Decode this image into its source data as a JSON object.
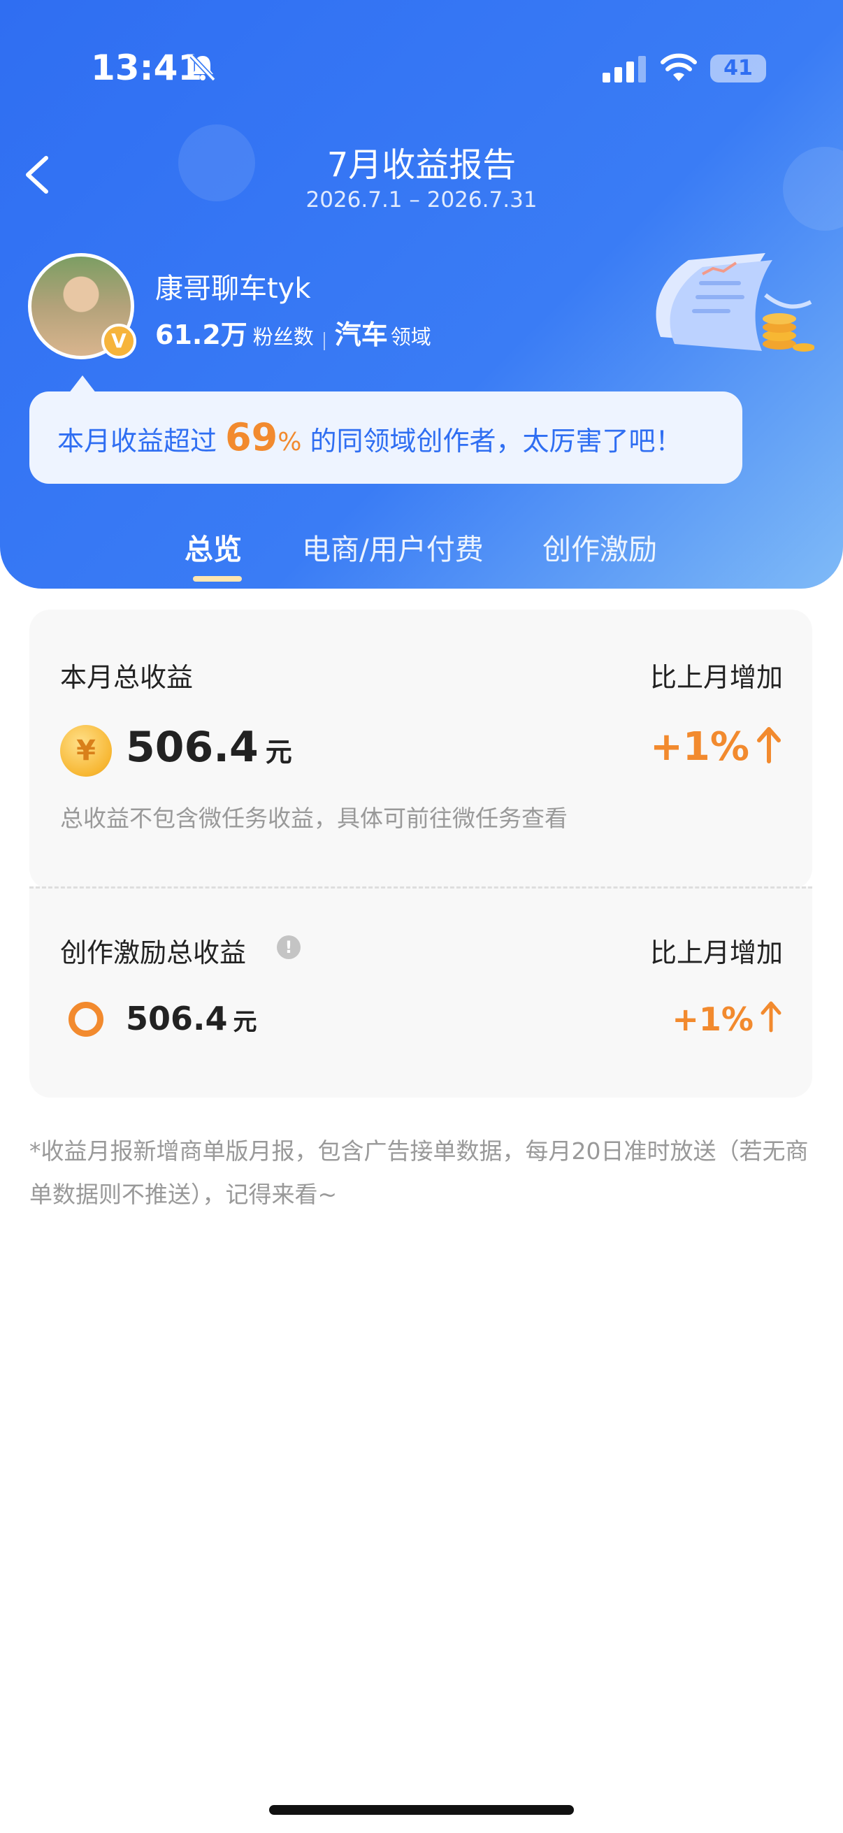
{
  "status_bar": {
    "time": "13:41",
    "battery": "41"
  },
  "header": {
    "title": "7月收益报告",
    "date_range": "2026.7.1 – 2026.7.31"
  },
  "profile": {
    "name": "康哥聊车tyk",
    "fans_count": "61.2万",
    "fans_label": "粉丝数",
    "field": "汽车",
    "field_label": "领域",
    "badge": "V"
  },
  "banner": {
    "prefix": "本月收益超过 ",
    "percent": "69",
    "percent_sign": "%",
    "suffix": " 的同领域创作者，太厉害了吧！"
  },
  "tabs": [
    {
      "label": "总览",
      "active": true
    },
    {
      "label": "电商/用户付费",
      "active": false
    },
    {
      "label": "创作激励",
      "active": false
    }
  ],
  "total_income": {
    "label": "本月总收益",
    "compare_label": "比上月增加",
    "amount": "506.4",
    "unit": "元",
    "growth": "+1%",
    "coin_symbol": "¥",
    "note": "总收益不包含微任务收益，具体可前往微任务查看"
  },
  "incentive_income": {
    "label": "创作激励总收益",
    "compare_label": "比上月增加",
    "amount": "506.4",
    "unit": "元",
    "growth": "+1%",
    "info_symbol": "!"
  },
  "footnote": "*收益月报新增商单版月报，包含广告接单数据，每月20日准时放送（若无商单数据则不推送），记得来看~",
  "colors": {
    "primary_blue": "#2f6ef2",
    "accent_orange": "#f28a2e",
    "card_bg": "#f8f8f8"
  },
  "icons": [
    "bell-muted-icon",
    "signal-icon",
    "wifi-icon",
    "battery-icon",
    "back-arrow-icon",
    "verified-badge-icon",
    "coin-icon",
    "ring-icon",
    "info-icon",
    "arrow-up-icon",
    "receipt-illustration"
  ]
}
